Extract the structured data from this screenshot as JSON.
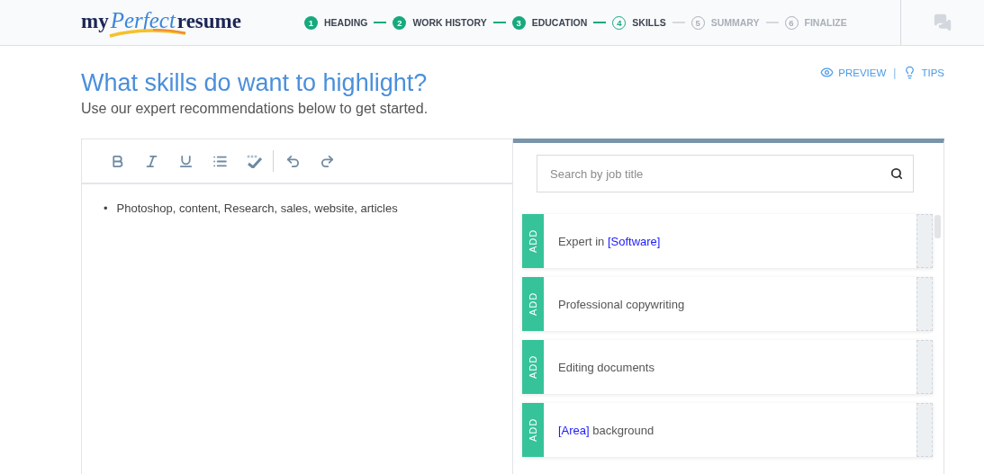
{
  "logo": {
    "parts": [
      "my",
      "Perfect",
      "resume"
    ]
  },
  "steps": [
    {
      "number": "1",
      "label": "HEADING",
      "done": true,
      "selected": false
    },
    {
      "number": "2",
      "label": "WORK HISTORY",
      "done": true,
      "selected": false
    },
    {
      "number": "3",
      "label": "EDUCATION",
      "done": true,
      "selected": false
    },
    {
      "number": "4",
      "label": "SKILLS",
      "done": false,
      "selected": true
    },
    {
      "number": "5",
      "label": "SUMMARY",
      "done": false,
      "selected": false
    },
    {
      "number": "6",
      "label": "FINALIZE",
      "done": false,
      "selected": false
    }
  ],
  "header_actions": {
    "preview": "PREVIEW",
    "separator": "|",
    "tips": "TIPS"
  },
  "title": "What skills do want to highlight?",
  "subtitle": "Use our expert recommendations below to get started.",
  "editor": {
    "bullets": [
      {
        "marker": "•",
        "text": "Photoshop, content, Research, sales, website, articles"
      }
    ]
  },
  "search": {
    "placeholder": "Search by job title"
  },
  "suggestions": [
    {
      "add_label": "ADD",
      "parts": [
        {
          "text": "Expert in ",
          "kind": "plain"
        },
        {
          "text": "[Software]",
          "kind": "token"
        }
      ]
    },
    {
      "add_label": "ADD",
      "parts": [
        {
          "text": "Professional copywriting",
          "kind": "plain"
        }
      ]
    },
    {
      "add_label": "ADD",
      "parts": [
        {
          "text": "Editing documents",
          "kind": "plain"
        }
      ]
    },
    {
      "add_label": "ADD",
      "parts": [
        {
          "text": "[Area]",
          "kind": "token"
        },
        {
          "text": " background",
          "kind": "plain"
        }
      ]
    }
  ]
}
